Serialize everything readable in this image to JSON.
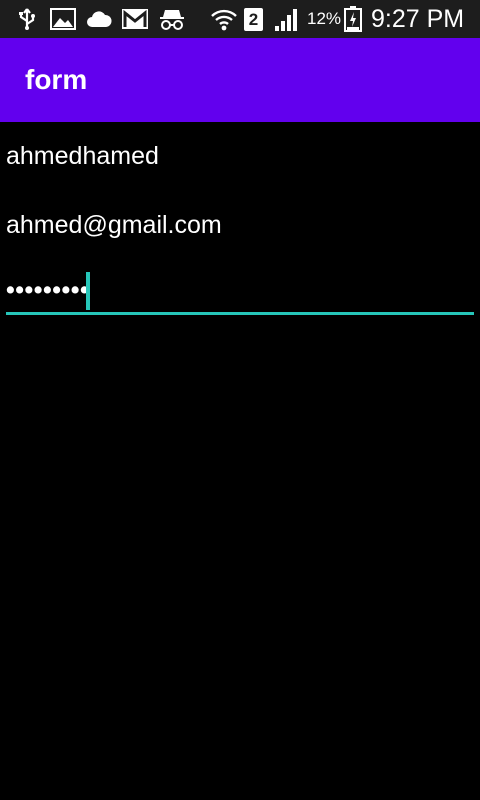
{
  "status_bar": {
    "icons": [
      "usb-icon",
      "image-icon",
      "cloud-icon",
      "gmail-icon",
      "incognito-icon",
      "wifi-icon",
      "sim-icon",
      "signal-icon",
      "battery-icon"
    ],
    "sim_slot": "2",
    "battery": "12%",
    "time": "9:27 PM"
  },
  "app_bar": {
    "title": "form",
    "color": "#6200ee"
  },
  "form": {
    "name_value": "ahmedhamed",
    "email_value": "ahmed@gmail.com",
    "password_mask": "•••••••••",
    "accent_color": "#26c6b9"
  }
}
